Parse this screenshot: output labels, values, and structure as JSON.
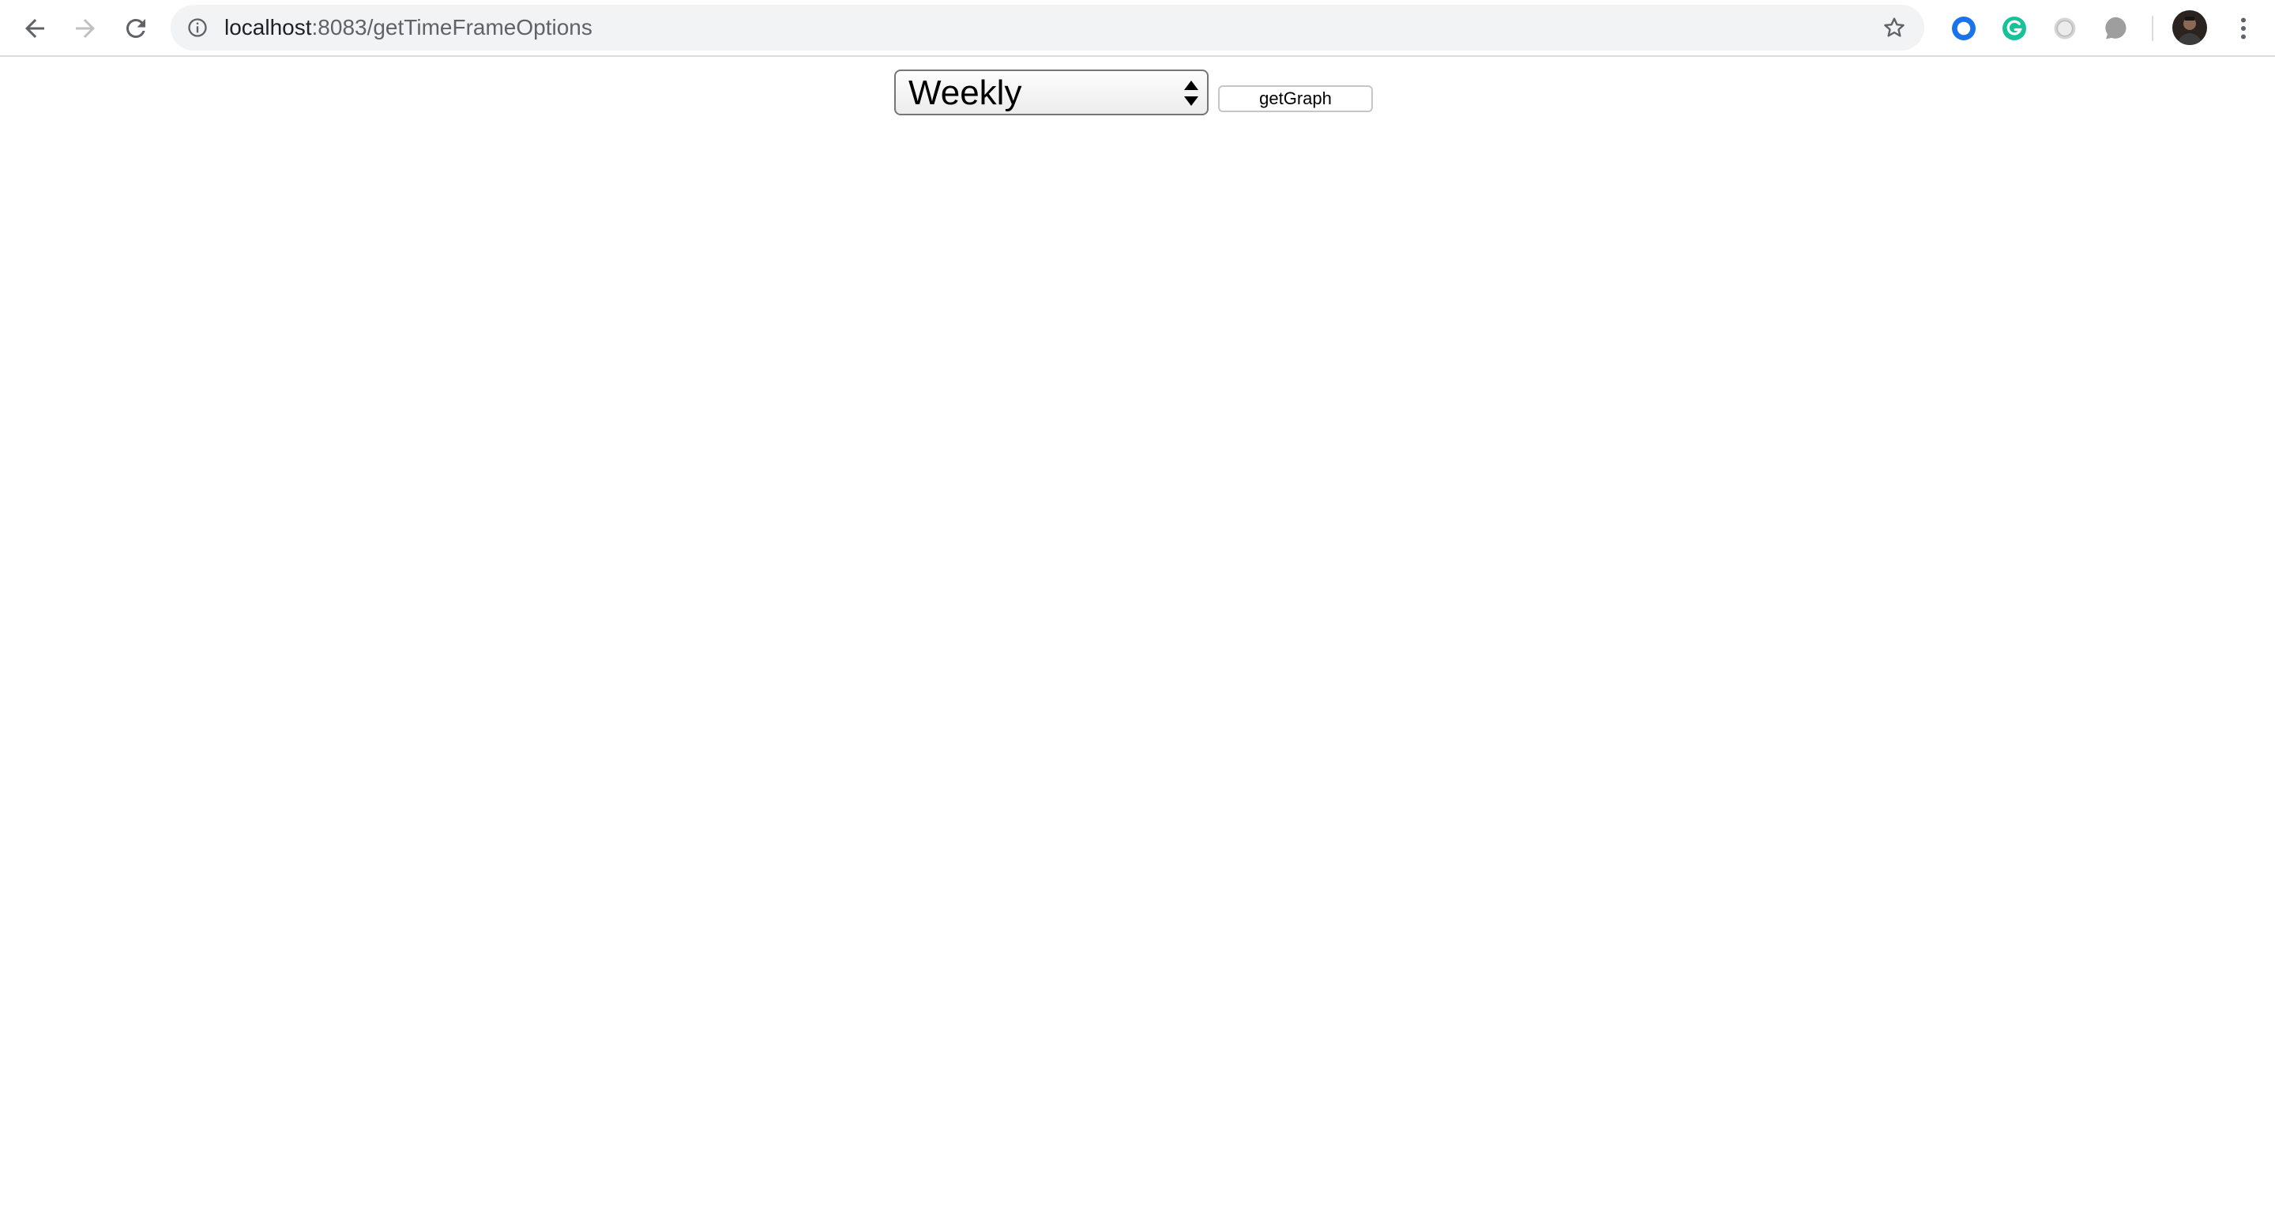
{
  "browser": {
    "url_host": "localhost",
    "url_path": ":8083/getTimeFrameOptions",
    "icons": {
      "back": "back-arrow-icon",
      "forward": "forward-arrow-icon",
      "reload": "reload-icon",
      "site_info": "info-icon",
      "bookmark": "star-icon",
      "menu": "kebab-menu-icon"
    },
    "extensions": [
      {
        "name": "blue-ring-extension-icon",
        "color": "#1a73e8"
      },
      {
        "name": "grammarly-icon",
        "color": "#15c39a"
      },
      {
        "name": "grey-circle-extension-icon",
        "color": "#bdbdbd"
      },
      {
        "name": "grey-bubble-extension-icon",
        "color": "#9e9e9e"
      }
    ]
  },
  "page": {
    "timeframe_select": {
      "selected": "Weekly"
    },
    "get_graph_label": "getGraph"
  }
}
